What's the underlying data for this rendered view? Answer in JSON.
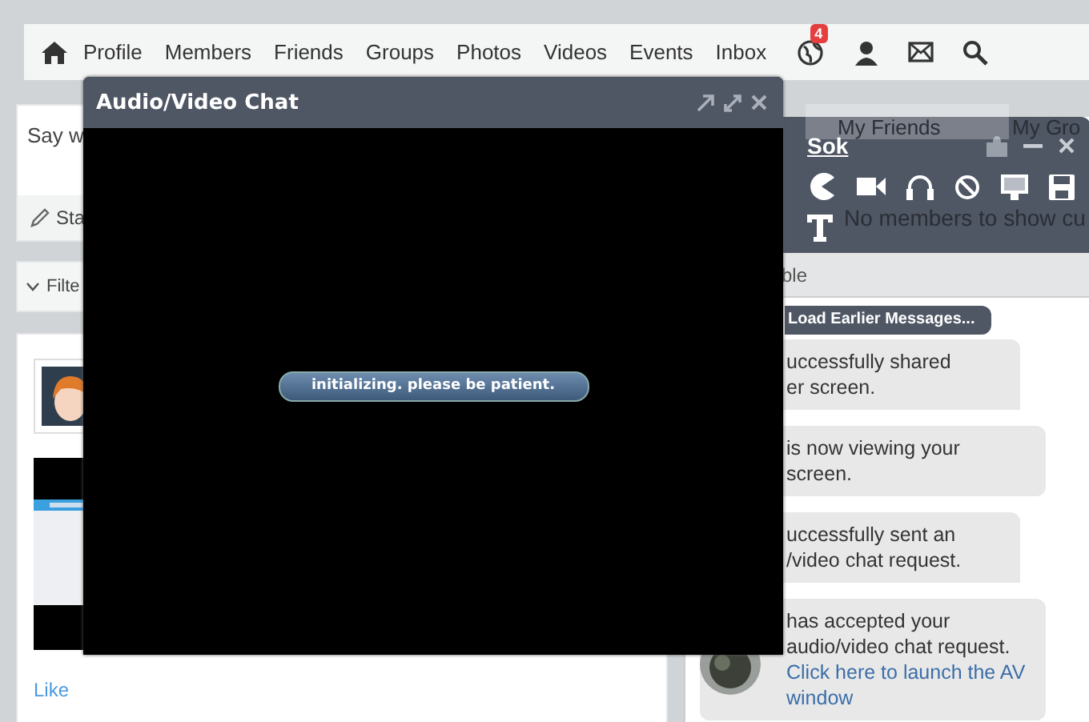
{
  "nav": {
    "items": [
      {
        "label": "Profile"
      },
      {
        "label": "Members"
      },
      {
        "label": "Friends"
      },
      {
        "label": "Groups"
      },
      {
        "label": "Photos"
      },
      {
        "label": "Videos"
      },
      {
        "label": "Events"
      },
      {
        "label": "Inbox"
      }
    ],
    "notification_count": "4"
  },
  "status_box": {
    "prompt": "Say w",
    "button": "Sta"
  },
  "filter": {
    "label": "Filte"
  },
  "post": {
    "like": "Like"
  },
  "friends_panel": {
    "tabs": [
      {
        "label": "My Friends",
        "selected": true
      },
      {
        "label": "My Gro",
        "selected": false
      }
    ],
    "empty_text": "No members to show cu"
  },
  "av_window": {
    "title": "Audio/Video Chat",
    "status": "initializing. please be patient."
  },
  "chat_window": {
    "name": "Sok",
    "status": "ble",
    "load_button": "Load Earlier Messages...",
    "messages": [
      {
        "text": "uccessfully shared\ner screen.",
        "tail": true
      },
      {
        "text": "is now viewing your\nscreen.",
        "tail": false
      },
      {
        "text": "uccessfully sent an\n/video chat request.",
        "tail": true
      },
      {
        "text": "has accepted your\naudio/video chat request.",
        "link": "Click here to launch the AV window",
        "tail": false,
        "avatar": true
      }
    ]
  }
}
